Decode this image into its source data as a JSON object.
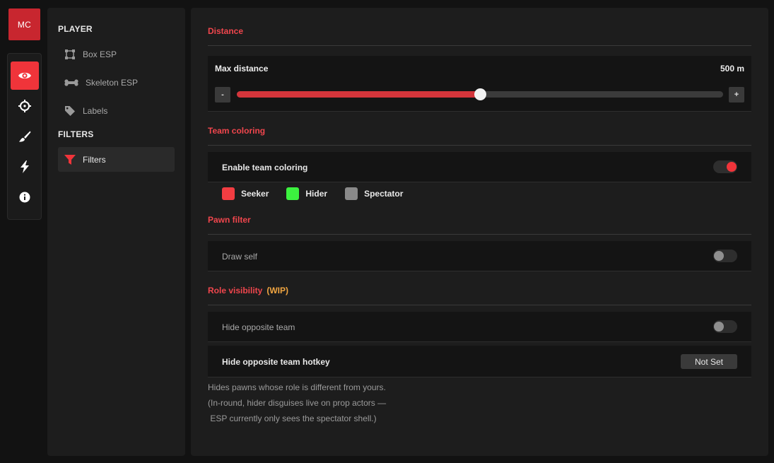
{
  "logo": {
    "text": "MC"
  },
  "iconbar": [
    {
      "icon": "eye-icon",
      "active": true
    },
    {
      "icon": "crosshair-icon",
      "active": false
    },
    {
      "icon": "brush-icon",
      "active": false
    },
    {
      "icon": "lightning-icon",
      "active": false
    },
    {
      "icon": "info-icon",
      "active": false
    }
  ],
  "subnav": {
    "player_heading": "PLAYER",
    "items": [
      {
        "label": "Box ESP",
        "icon": "box-icon"
      },
      {
        "label": "Skeleton ESP",
        "icon": "bone-icon"
      },
      {
        "label": "Labels",
        "icon": "tag-icon"
      }
    ],
    "filters_heading": "FILTERS",
    "filters_item": {
      "label": "Filters",
      "icon": "funnel-icon",
      "active": true
    }
  },
  "distance": {
    "title": "Distance",
    "label": "Max distance",
    "value_text": "500 m",
    "fraction": 0.5,
    "minus": "-",
    "plus": "+"
  },
  "team": {
    "title": "Team coloring",
    "enable_label": "Enable team coloring",
    "enabled": true,
    "colors": [
      {
        "label": "Seeker",
        "color": "#f23d42"
      },
      {
        "label": "Hider",
        "color": "#3cf23f"
      },
      {
        "label": "Spectator",
        "color": "#8a8a8a"
      }
    ]
  },
  "pawn": {
    "title": "Pawn filter",
    "draw_self_label": "Draw self",
    "draw_self": false
  },
  "role": {
    "title": "Role visibility",
    "tag": "(WIP)",
    "hide_opposite_label": "Hide opposite team",
    "hide_opposite": false,
    "hotkey_label": "Hide opposite team hotkey",
    "hotkey_value": "Not Set",
    "notes": [
      "Hides pawns whose role is different from yours.",
      "(In-round, hider disguises live on prop actors —",
      " ESP currently only sees the spectator shell.)"
    ]
  },
  "colors": {
    "accent": "#f0343a",
    "section_title": "#f0464d",
    "wip": "#f0a541"
  }
}
